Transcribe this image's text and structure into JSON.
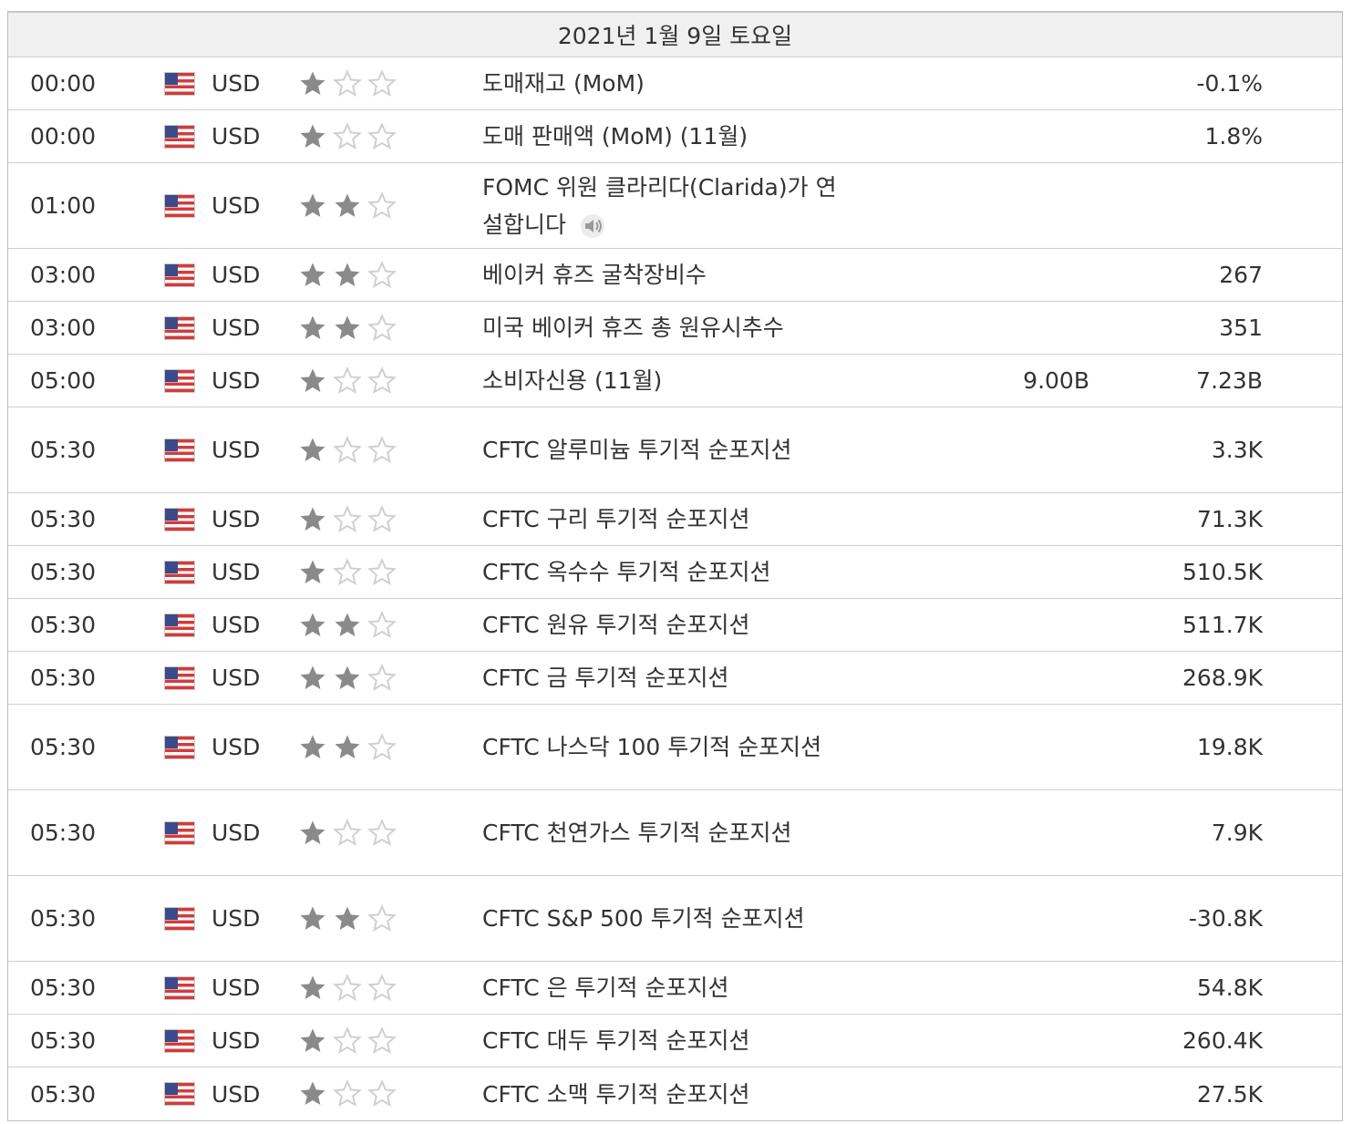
{
  "calendar": {
    "date_header": "2021년 1월 9일 토요일",
    "colors": {
      "star_filled": "#8a8a8a",
      "star_empty": "#d0d0d0",
      "flag_red": "#d33b3b",
      "flag_blue": "#3b4a88"
    },
    "events": [
      {
        "time": "00:00",
        "currency": "USD",
        "importance": 1,
        "event": "도매재고 (MoM)",
        "forecast": "",
        "actual": "-0.1%"
      },
      {
        "time": "00:00",
        "currency": "USD",
        "importance": 1,
        "event": "도매 판매액 (MoM) (11월)",
        "forecast": "",
        "actual": "1.8%"
      },
      {
        "time": "01:00",
        "currency": "USD",
        "importance": 2,
        "event": "FOMC 위원 클라리다(Clarida)가 연설합니다",
        "speech": true,
        "forecast": "",
        "actual": ""
      },
      {
        "time": "03:00",
        "currency": "USD",
        "importance": 2,
        "event": "베이커 휴즈 굴착장비수",
        "forecast": "",
        "actual": "267"
      },
      {
        "time": "03:00",
        "currency": "USD",
        "importance": 2,
        "event": "미국 베이커 휴즈 총 원유시추수",
        "forecast": "",
        "actual": "351"
      },
      {
        "time": "05:00",
        "currency": "USD",
        "importance": 1,
        "event": "소비자신용 (11월)",
        "forecast": "9.00B",
        "actual": "7.23B"
      },
      {
        "time": "05:30",
        "currency": "USD",
        "importance": 1,
        "event": "CFTC 알루미늄 투기적 순포지션",
        "forecast": "",
        "actual": "3.3K"
      },
      {
        "time": "05:30",
        "currency": "USD",
        "importance": 1,
        "event": "CFTC 구리 투기적 순포지션",
        "forecast": "",
        "actual": "71.3K"
      },
      {
        "time": "05:30",
        "currency": "USD",
        "importance": 1,
        "event": "CFTC 옥수수 투기적 순포지션",
        "forecast": "",
        "actual": "510.5K"
      },
      {
        "time": "05:30",
        "currency": "USD",
        "importance": 2,
        "event": "CFTC 원유 투기적 순포지션",
        "forecast": "",
        "actual": "511.7K"
      },
      {
        "time": "05:30",
        "currency": "USD",
        "importance": 2,
        "event": "CFTC 금 투기적 순포지션",
        "forecast": "",
        "actual": "268.9K"
      },
      {
        "time": "05:30",
        "currency": "USD",
        "importance": 2,
        "event": "CFTC 나스닥 100 투기적 순포지션",
        "forecast": "",
        "actual": "19.8K"
      },
      {
        "time": "05:30",
        "currency": "USD",
        "importance": 1,
        "event": "CFTC 천연가스 투기적 순포지션",
        "forecast": "",
        "actual": "7.9K"
      },
      {
        "time": "05:30",
        "currency": "USD",
        "importance": 2,
        "event": "CFTC S&P 500 투기적 순포지션",
        "forecast": "",
        "actual": "-30.8K"
      },
      {
        "time": "05:30",
        "currency": "USD",
        "importance": 1,
        "event": "CFTC 은 투기적 순포지션",
        "forecast": "",
        "actual": "54.8K"
      },
      {
        "time": "05:30",
        "currency": "USD",
        "importance": 1,
        "event": "CFTC 대두 투기적 순포지션",
        "forecast": "",
        "actual": "260.4K"
      },
      {
        "time": "05:30",
        "currency": "USD",
        "importance": 1,
        "event": "CFTC 소맥 투기적 순포지션",
        "forecast": "",
        "actual": "27.5K"
      }
    ]
  }
}
